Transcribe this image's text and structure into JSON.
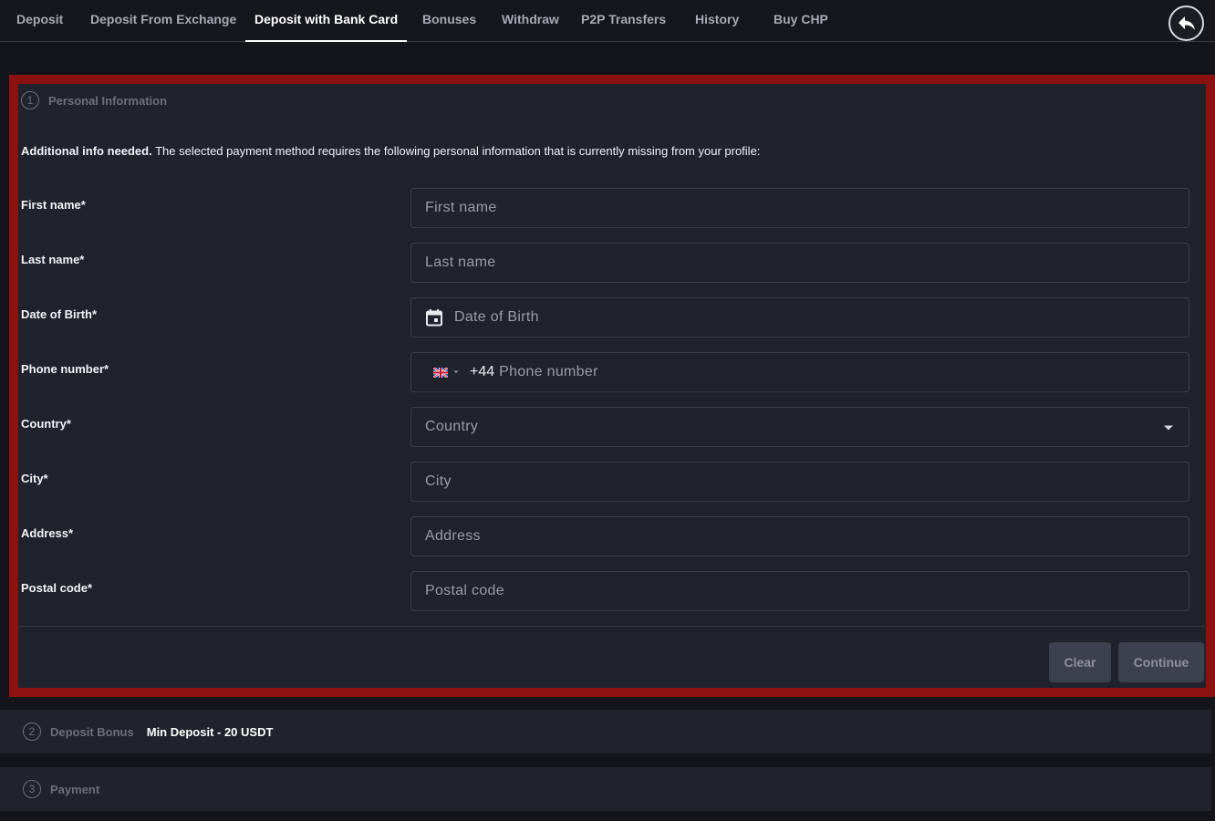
{
  "nav": {
    "tabs": [
      {
        "label": "Deposit"
      },
      {
        "label": "Deposit From Exchange"
      },
      {
        "label": "Deposit with Bank Card"
      },
      {
        "label": "Bonuses"
      },
      {
        "label": "Withdraw"
      },
      {
        "label": "P2P Transfers"
      },
      {
        "label": "History"
      },
      {
        "label": "Buy CHP"
      }
    ],
    "active_tab": "Deposit with Bank Card",
    "back_icon": "back-arrow-icon"
  },
  "step1": {
    "number": "1",
    "title": "Personal Information",
    "notice_bold": "Additional info needed.",
    "notice_text": " The selected payment method requires the following personal information that is currently missing from your profile:",
    "fields": [
      {
        "label": "First name*",
        "placeholder": "First name"
      },
      {
        "label": "Last name*",
        "placeholder": "Last name"
      },
      {
        "label": "Date of Birth*",
        "placeholder": "Date of Birth"
      },
      {
        "label": "Phone number*",
        "placeholder": "Phone number",
        "prefix": "+44"
      },
      {
        "label": "Country*",
        "placeholder": "Country"
      },
      {
        "label": "City*",
        "placeholder": "City"
      },
      {
        "label": "Address*",
        "placeholder": "Address"
      },
      {
        "label": "Postal code*",
        "placeholder": "Postal code"
      }
    ],
    "clear_label": "Clear",
    "continue_label": "Continue"
  },
  "step2": {
    "number": "2",
    "title": "Deposit Bonus",
    "min_deposit": "Min Deposit - 20 USDT"
  },
  "step3": {
    "number": "3",
    "title": "Payment"
  },
  "colors": {
    "highlight_border": "#8c1212",
    "panel_bg": "#21232c",
    "page_bg": "#16171c"
  }
}
